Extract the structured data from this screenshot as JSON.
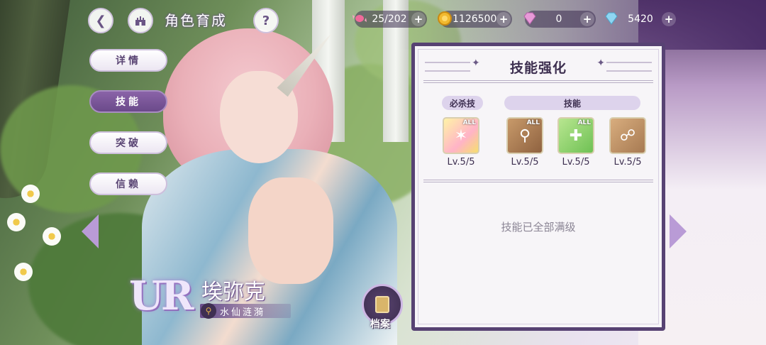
{
  "header": {
    "title": "角色育成",
    "back_icon": "back-arrow-icon",
    "home_icon": "castle-home-icon",
    "help_label": "?"
  },
  "resources": {
    "candy": {
      "value": "25/202",
      "icon": "candy-icon"
    },
    "coin": {
      "value": "1126500",
      "icon": "coin-icon"
    },
    "gem": {
      "value": "0",
      "icon": "pink-gem-icon"
    },
    "diamond": {
      "value": "5420",
      "icon": "blue-diamond-icon"
    },
    "plus_label": "+"
  },
  "side_menu": {
    "items": [
      {
        "label": "详情",
        "active": false
      },
      {
        "label": "技能",
        "active": true
      },
      {
        "label": "突破",
        "active": false
      },
      {
        "label": "信赖",
        "active": false
      }
    ]
  },
  "character": {
    "rarity": "UR",
    "name": "埃弥克",
    "title": "水仙涟漪"
  },
  "archive": {
    "label": "档案"
  },
  "panel": {
    "title": "技能强化",
    "ultimate_tag": "必杀技",
    "skill_tag": "技能",
    "all_badge": "ALL",
    "skills": [
      {
        "level": "Lv.5/5",
        "icon": "ultimate-sparkle-icon",
        "all": true
      },
      {
        "level": "Lv.5/5",
        "icon": "key-skill-icon",
        "all": true
      },
      {
        "level": "Lv.5/5",
        "icon": "heal-clover-icon",
        "all": true
      },
      {
        "level": "Lv.5/5",
        "icon": "chain-skill-icon",
        "all": false
      }
    ],
    "message": "技能已全部满级"
  },
  "colors": {
    "accent_purple": "#574273",
    "active_tab": "#7a56a0",
    "panel_bg": "#f7f5f8"
  }
}
